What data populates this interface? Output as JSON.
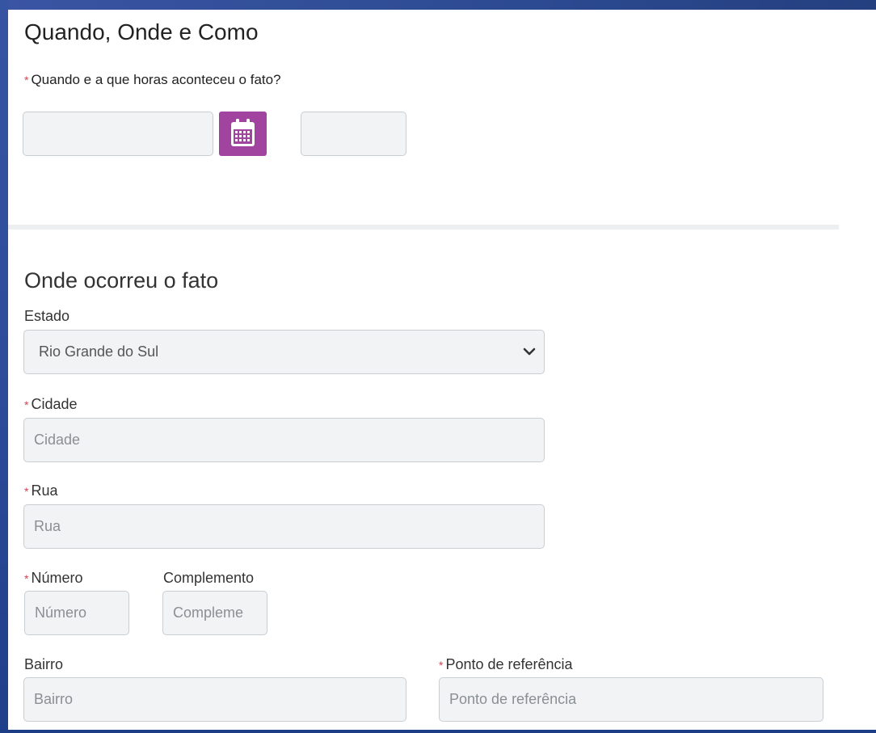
{
  "header": {
    "title": "Quando, Onde e Como"
  },
  "when": {
    "required_mark": "*",
    "question": "Quando e a que horas aconteceu o fato?",
    "date_value": "",
    "time_value": "",
    "calendar_icon": "calendar-icon"
  },
  "where": {
    "title": "Onde ocorreu o fato",
    "estado": {
      "label": "Estado",
      "selected": "Rio Grande do Sul",
      "icon": "chevron-down-icon"
    },
    "cidade": {
      "required_mark": "*",
      "label": "Cidade",
      "placeholder": "Cidade"
    },
    "rua": {
      "required_mark": "*",
      "label": "Rua",
      "placeholder": "Rua"
    },
    "numero": {
      "required_mark": "*",
      "label": "Número",
      "placeholder": "Número"
    },
    "complemento": {
      "label": "Complemento",
      "placeholder": "Compleme"
    },
    "bairro": {
      "label": "Bairro",
      "placeholder": "Bairro"
    },
    "ponto": {
      "required_mark": "*",
      "label": "Ponto de referência",
      "placeholder": "Ponto de referência"
    }
  },
  "colors": {
    "accent": "#a0449f",
    "required": "#d8404d",
    "frame": "#2c4a92"
  }
}
